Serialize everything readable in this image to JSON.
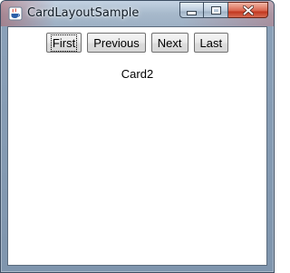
{
  "window": {
    "title": "CardLayoutSample",
    "app_icon": "java-coffee-cup-icon",
    "controls": {
      "minimize_icon": "minimize-icon",
      "maximize_icon": "maximize-icon",
      "close_icon": "close-icon"
    }
  },
  "toolbar": {
    "buttons": [
      {
        "label": "First",
        "focused": true
      },
      {
        "label": "Previous",
        "focused": false
      },
      {
        "label": "Next",
        "focused": false
      },
      {
        "label": "Last",
        "focused": false
      }
    ]
  },
  "card": {
    "label": "Card2"
  },
  "colors": {
    "close_button": "#c1361e",
    "content_background": "#ffffff"
  }
}
